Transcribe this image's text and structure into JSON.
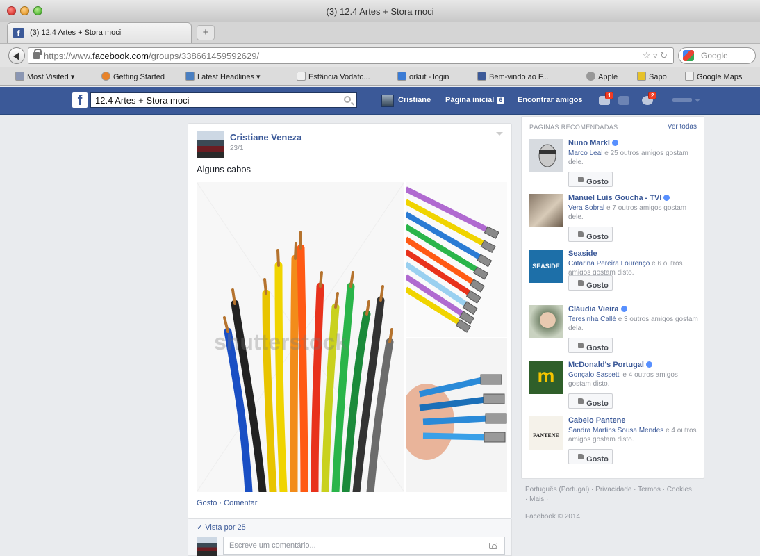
{
  "window": {
    "title": "(3) 12.4 Artes + Stora moci",
    "tab_label": "(3) 12.4 Artes + Stora moci",
    "new_tab_symbol": "+"
  },
  "address": {
    "url_prefix": "https://www.",
    "url_domain": "facebook.com",
    "url_path": "/groups/338661459592629/",
    "search_placeholder": "Google"
  },
  "bookmarks": [
    {
      "label": "Most Visited ▾",
      "icon": "most-visited-icon"
    },
    {
      "label": "Getting Started",
      "icon": "firefox-icon"
    },
    {
      "label": "Latest Headlines ▾",
      "icon": "rss-icon"
    },
    {
      "label": "Estância Vodafo...",
      "icon": "page-icon"
    },
    {
      "label": "orkut - login",
      "icon": "orkut-icon"
    },
    {
      "label": "Bem-vindo ao F...",
      "icon": "facebook-icon"
    },
    {
      "label": "Apple",
      "icon": "apple-icon"
    },
    {
      "label": "Sapo",
      "icon": "sapo-icon"
    },
    {
      "label": "Google Maps",
      "icon": "page-icon"
    }
  ],
  "fb": {
    "search_value": "12.4 Artes + Stora moci",
    "nav_user": "Cristiane",
    "nav_home": "Página inicial",
    "nav_home_count": "6",
    "nav_find_friends": "Encontrar amigos",
    "friend_requests_badge": "1",
    "notifications_badge": "2",
    "brand_color": "#3b5998"
  },
  "post": {
    "author": "Cristiane Veneza",
    "date": "23/1",
    "text": "Alguns cabos",
    "watermark": "shutterstock",
    "like_action": "Gosto",
    "separator": " · ",
    "comment_action": "Comentar",
    "seen_by": "✓ Vista por 25",
    "comment_placeholder": "Escreve um comentário..."
  },
  "recommended": {
    "title": "PÁGINAS RECOMENDADAS",
    "see_all": "Ver todas",
    "like_label": "Gosto",
    "items": [
      {
        "name": "Nuno Markl",
        "verified": true,
        "friend": "Marco Leal",
        "rest": " e 25 outros amigos gostam dele."
      },
      {
        "name": "Manuel Luís Goucha - TVI",
        "verified": true,
        "friend": "Vera Sobral",
        "rest": " e 7 outros amigos gostam dele."
      },
      {
        "name": "Seaside",
        "verified": false,
        "friend": "Catarina Pereira Lourenço",
        "rest": " e 6 outros amigos gostam disto.",
        "thumb_text": "SEASIDE"
      },
      {
        "name": "Cláudia Vieira",
        "verified": true,
        "friend": "Teresinha Callé",
        "rest": " e 3 outros amigos gostam dela."
      },
      {
        "name": "McDonald's Portugal",
        "verified": true,
        "friend": "Gonçalo Sassetti",
        "rest": " e 4 outros amigos gostam disto.",
        "thumb_text": "m"
      },
      {
        "name": "Cabelo Pantene",
        "verified": false,
        "friend": "Sandra Martins Sousa Mendes",
        "rest": " e 4 outros amigos gostam disto.",
        "thumb_text": "PANTENE"
      }
    ]
  },
  "footer": {
    "links": "Português (Portugal) · Privacidade · Termos · Cookies · Mais ·",
    "copyright": "Facebook © 2014"
  }
}
